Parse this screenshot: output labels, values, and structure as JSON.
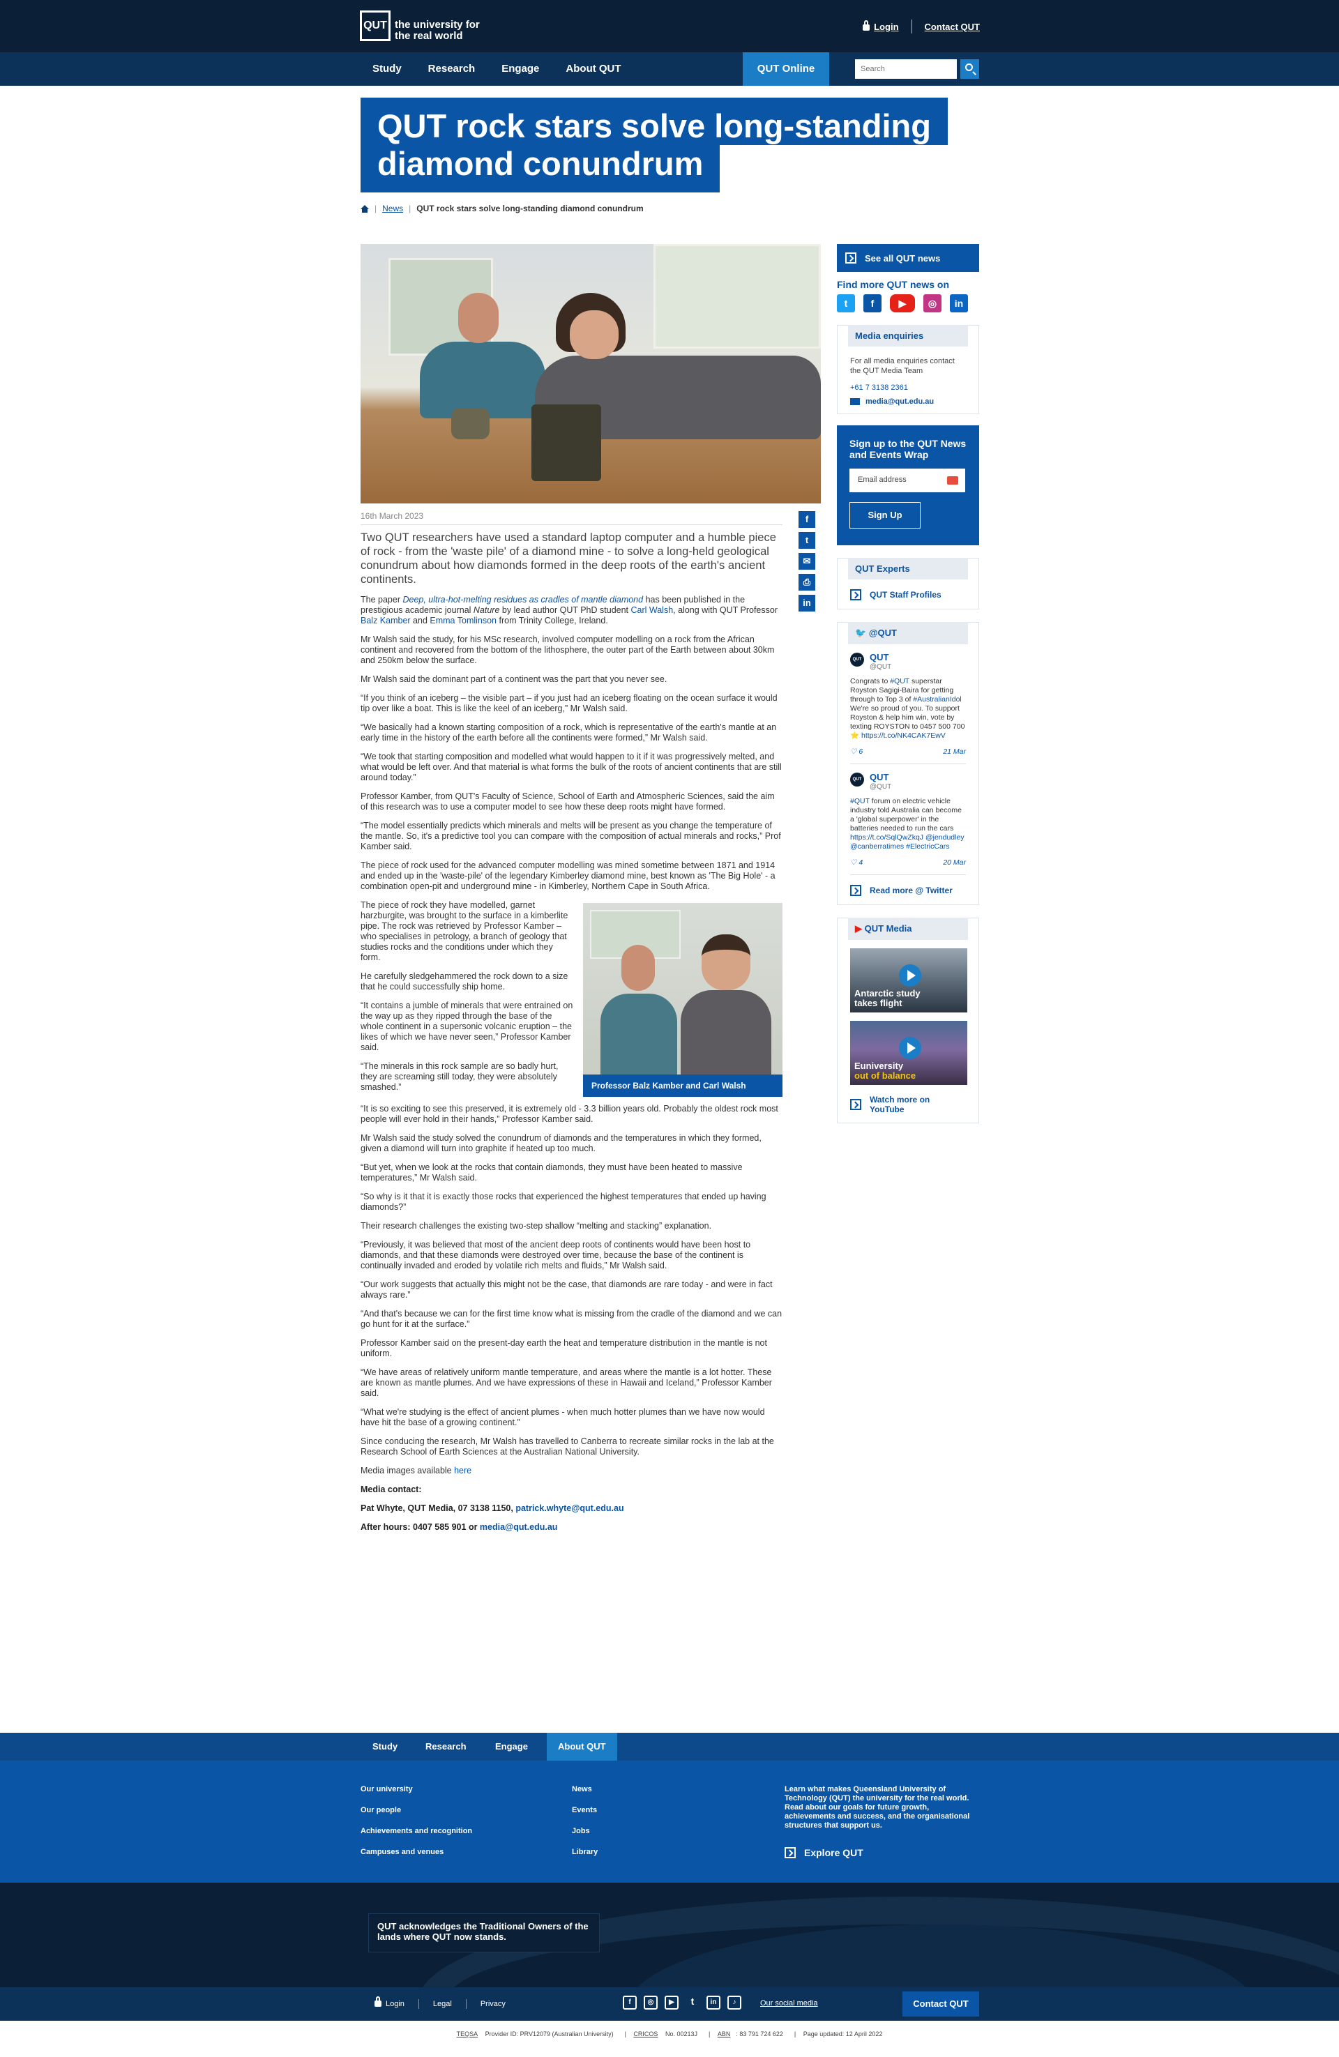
{
  "header": {
    "logo_mark": "QUT",
    "logo_text": "the university for the real world",
    "login": "Login",
    "contact": "Contact QUT"
  },
  "nav": {
    "items": [
      "Study",
      "Research",
      "Engage",
      "About QUT"
    ],
    "online": "QUT Online",
    "search_placeholder": "Search"
  },
  "title": {
    "line1": "QUT rock stars solve long-standing",
    "line2": "diamond conundrum"
  },
  "breadcrumb": {
    "news": "News",
    "current": "QUT rock stars solve long-standing diamond conundrum"
  },
  "article": {
    "date": "16th March 2023",
    "lead": "Two QUT researchers have used a standard laptop computer and a humble piece of rock - from the 'waste pile' of a diamond mine - to solve a long-held geological conundrum about how diamonds formed in the deep roots of the earth's ancient continents.",
    "p1_a": "The paper ",
    "p1_link": "Deep, ultra-hot-melting residues as cradles of mantle diamond",
    "p1_b": " has been published in the prestigious academic journal ",
    "p1_journal": "Nature",
    "p1_c": " by lead author QUT PhD student ",
    "p1_walsh": "Carl Walsh",
    "p1_d": ", along with QUT Professor ",
    "p1_kamber": "Balz Kamber",
    "p1_e": " and ",
    "p1_tomlinson": "Emma Tomlinson",
    "p1_f": " from Trinity College, Ireland.",
    "p2": "Mr Walsh said the study, for his MSc research, involved computer modelling on a rock from the African continent and recovered from the bottom of the lithosphere, the outer part of the Earth between about 30km and 250km below the surface.",
    "p3": "Mr Walsh said the dominant part of a continent was the part that you never see.",
    "p4": "“If you think of an iceberg – the visible part – if you just had an iceberg floating on the ocean surface it would tip over like a boat. This is like the keel of an iceberg,” Mr Walsh said.",
    "p5": "“We basically had a known starting composition of a rock, which is representative of the earth's mantle at an early time in the history of the earth before all the continents were formed,” Mr Walsh said.",
    "p6": "“We took that starting composition and modelled what would happen to it if it was progressively melted, and what would be left over. And that material is what forms the bulk of the roots of ancient continents that are still around today.”",
    "p7": "Professor Kamber, from QUT's Faculty of Science, School of Earth and Atmospheric Sciences, said the aim of this research was to use a computer model to see how these deep roots might have formed.",
    "p8": "“The model essentially predicts which minerals and melts will be present as you change the temperature of the mantle. So, it's a predictive tool you can compare with the composition of actual minerals and rocks,” Prof Kamber said.",
    "p9": "The piece of rock used for the advanced computer modelling was mined sometime between 1871 and 1914 and ended up in the 'waste-pile' of the legendary Kimberley diamond mine, best known as 'The Big Hole' - a combination open-pit and underground mine - in Kimberley, Northern Cape in South Africa.",
    "p10": "The piece of rock they have modelled, garnet harzburgite, was brought to the surface in a kimberlite pipe. The rock was retrieved by Professor Kamber – who specialises in petrology, a branch of geology that studies rocks and the conditions under which they form.",
    "p11": "He carefully sledgehammered the rock down to a size that he could successfully ship home.",
    "p12": "“It contains a jumble of minerals that were entrained on the way up as they ripped through the base of the whole continent in a supersonic volcanic eruption – the likes of which we have never seen,” Professor Kamber said.",
    "p13": "“The minerals in this rock sample are so badly hurt, they are screaming still today, they were absolutely smashed.”",
    "p14": "“It is so exciting to see this preserved, it is extremely old - 3.3 billion years old. Probably the oldest rock most people will ever hold in their hands,” Professor Kamber said.",
    "p15": "Mr Walsh said the study solved the conundrum of diamonds and the temperatures in which they formed, given a diamond will turn into graphite if heated up too much.",
    "p16": "“But yet, when we look at the rocks that contain diamonds, they must have been heated to massive temperatures,” Mr Walsh said.",
    "p17": "“So why is it that it is exactly those rocks that experienced the highest temperatures that ended up having diamonds?”",
    "p18": "Their research challenges the existing two-step shallow “melting and stacking” explanation.",
    "p19": "“Previously, it was believed that most of the ancient deep roots of continents would have been host to diamonds, and that these diamonds were destroyed over time, because the base of the continent is continually invaded and eroded by volatile rich melts and fluids,” Mr Walsh said.",
    "p20": "“Our work suggests that actually this might not be the case, that diamonds are rare today - and were in fact always rare.”",
    "p21": "“And that's because we can for the first time know what is missing from the cradle of the diamond and we can go hunt for it at the surface.”",
    "p22": "Professor Kamber said on the present-day earth the heat and temperature distribution in the mantle is not uniform.",
    "p23": "“We have areas of relatively uniform mantle temperature, and areas where the mantle is a lot hotter. These are known as mantle plumes. And we have expressions of these in Hawaii and Iceland,” Professor Kamber said.",
    "p24": "“What we're studying is the effect of ancient plumes - when much hotter plumes than we have now would have hit the base of a growing continent.”",
    "p25": "Since conducing the research, Mr Walsh has travelled to Canberra to recreate similar rocks in the lab at the Research School of Earth Sciences at the Australian National University.",
    "images_text": "Media images available ",
    "images_link": "here",
    "media_contact": "Media contact:",
    "contact_line": "Pat Whyte, QUT Media, 07 3138 1150, ",
    "contact_email": "patrick.whyte@qut.edu.au",
    "after_hours": "After hours: 0407 585 901 or ",
    "after_email": "media@qut.edu.au",
    "figure_caption": "Professor Balz Kamber and Carl Walsh"
  },
  "share": [
    "f",
    "t",
    "✉",
    "⎙",
    "in"
  ],
  "sidebar": {
    "all_news": "See all QUT news",
    "find_more": "Find more QUT news on",
    "social": [
      "t",
      "f",
      "▶",
      "◎",
      "in"
    ],
    "media_head": "Media enquiries",
    "media_text": "For all media enquiries contact the QUT Media Team",
    "media_phone": "+61 7 3138 2361",
    "media_email": "media@qut.edu.au",
    "signup_title": "Sign up to the QUT News and Events Wrap",
    "signup_placeholder": "Email address",
    "signup_btn": "Sign Up",
    "experts_head": "QUT Experts",
    "experts_link": "QUT Staff Profiles",
    "twitter_head": "@QUT",
    "tweets": [
      {
        "name": "QUT",
        "handle": "@QUT",
        "text_a": "Congrats to ",
        "tag": "#QUT",
        "text_b": " superstar Royston Sagigi-Baira for getting through to Top 3 of ",
        "tag2": "#AustralianIdol",
        "text_c": " We're so proud of you. To support Royston & help him win, vote by texting ROYSTON to 0457 500 700 ⭐ ",
        "link": "https://t.co/NK4CAK7EwV",
        "likes": "6",
        "date": "21 Mar"
      },
      {
        "name": "QUT",
        "handle": "@QUT",
        "text_a": "",
        "tag": "#QUT",
        "text_b": " forum on electric vehicle industry told Australia can become a 'global superpower' in the batteries needed to run the cars ",
        "tag2": "",
        "text_c": "",
        "link": "https://t.co/SqlQwZkqJ @jendudley @canberratimes #ElectricCars",
        "likes": "4",
        "date": "20 Mar"
      }
    ],
    "twitter_more": "Read more @ Twitter",
    "media_yt_head": "QUT Media",
    "videos": [
      {
        "cap_a": "Antar",
        "cap_b": "ctic study",
        "cap_c": "takes flight"
      },
      {
        "cap_a": "E",
        "cap_b": "university",
        "cap_c": "out of balance"
      }
    ],
    "yt_more": "Watch more on YouTube"
  },
  "footer": {
    "tabs": [
      "Study",
      "Research",
      "Engage",
      "About QUT"
    ],
    "col1": [
      "Our university",
      "Our people",
      "Achievements and recognition",
      "Campuses and venues"
    ],
    "col2": [
      "News",
      "Events",
      "Jobs",
      "Library"
    ],
    "about": "Learn what makes Queensland University of Technology (QUT) the university for the real world. Read about our goals for future growth, achievements and success, and the organisational structures that support us.",
    "explore": "Explore QUT",
    "ack": "QUT acknowledges the Traditional Owners of the lands where QUT now stands.",
    "login": "Login",
    "legal": "Legal",
    "privacy": "Privacy",
    "social_media": "Our social media",
    "contact": "Contact QUT",
    "teqsa": "TEQSA",
    "teqsa_val": " Provider ID: PRV12079 (Australian University)",
    "cricos": "CRICOS",
    "cricos_val": " No. 00213J",
    "abn": "ABN",
    "abn_val": ": 83 791 724 622",
    "updated": "Page updated: 12 April 2022"
  },
  "colors": {
    "primary": "#0a55a6",
    "dark": "#0b2036",
    "nav": "#0d3259",
    "accent": "#1b7dc6"
  }
}
